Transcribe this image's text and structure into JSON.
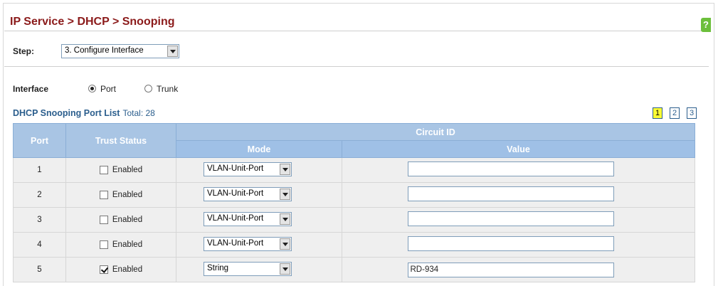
{
  "header": {
    "title": "IP Service > DHCP > Snooping"
  },
  "step": {
    "label": "Step:",
    "selected": "3. Configure Interface"
  },
  "interface": {
    "label": "Interface",
    "options": [
      {
        "label": "Port",
        "selected": true
      },
      {
        "label": "Trunk",
        "selected": false
      }
    ]
  },
  "list": {
    "title": "DHCP Snooping Port List",
    "total_label": "Total: 28",
    "pages": [
      "1",
      "2",
      "3"
    ],
    "current_page": "1"
  },
  "table": {
    "headers": {
      "port": "Port",
      "trust": "Trust Status",
      "circuit": "Circuit ID",
      "mode": "Mode",
      "value": "Value"
    },
    "rows": [
      {
        "port": "1",
        "trust_label": "Enabled",
        "trust_checked": false,
        "mode": "VLAN-Unit-Port",
        "value": ""
      },
      {
        "port": "2",
        "trust_label": "Enabled",
        "trust_checked": false,
        "mode": "VLAN-Unit-Port",
        "value": ""
      },
      {
        "port": "3",
        "trust_label": "Enabled",
        "trust_checked": false,
        "mode": "VLAN-Unit-Port",
        "value": ""
      },
      {
        "port": "4",
        "trust_label": "Enabled",
        "trust_checked": false,
        "mode": "VLAN-Unit-Port",
        "value": ""
      },
      {
        "port": "5",
        "trust_label": "Enabled",
        "trust_checked": true,
        "mode": "String",
        "value": "RD-934"
      }
    ]
  },
  "colors": {
    "title": "#8b1a1a",
    "link": "#2b5e8d",
    "header_bg": "#a9c5e4",
    "row_bg": "#efefef",
    "current_page": "#ffff33"
  }
}
